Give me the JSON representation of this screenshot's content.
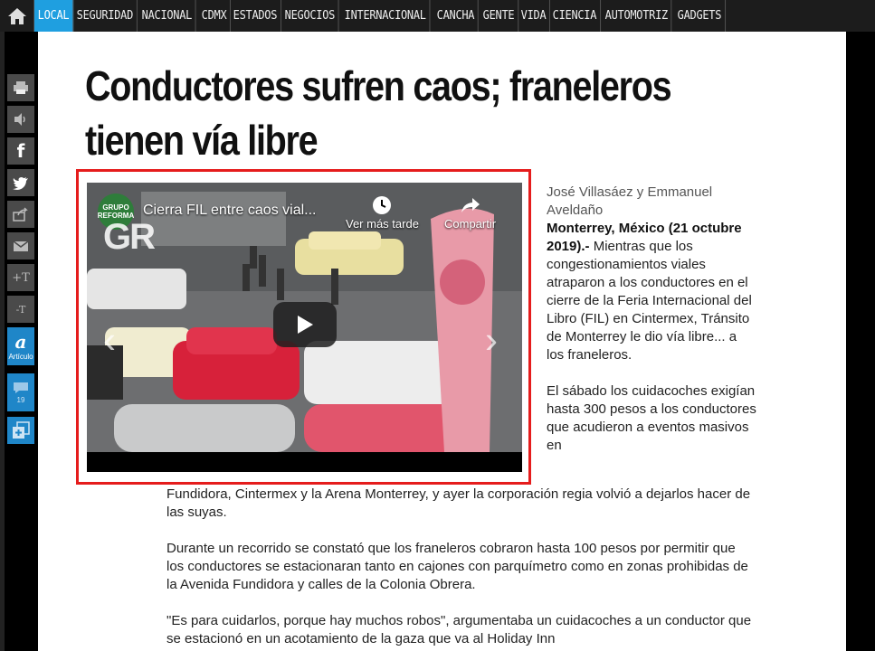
{
  "nav": {
    "items": [
      "LOCAL",
      "SEGURIDAD",
      "NACIONAL",
      "CDMX",
      "ESTADOS",
      "NEGOCIOS",
      "INTERNACIONAL",
      "CANCHA",
      "GENTE",
      "VIDA",
      "CIENCIA",
      "AUTOMOTRIZ",
      "GADGETS"
    ],
    "active": "LOCAL"
  },
  "sidebar": {
    "article_label": "Artículo",
    "comments_count": "19"
  },
  "article": {
    "title_line1": "Conductores sufren caos; franeleros",
    "title_line2": "tienen vía libre",
    "authors": "José Villasáez y Emmanuel Aveldaño",
    "dateline": "Monterrey, México (21 octubre 2019).-",
    "col_p1": "Mientras que los congestionamientos viales atraparon a los conductores en el cierre de la Feria Internacional del Libro (FIL) en Cintermex, Tránsito de Monterrey le dio vía libre... a los franeleros.",
    "col_p2": "El sábado los cuidacoches exigían hasta 300 pesos a los conductores que acudieron a eventos masivos en",
    "p2_cont": "Fundidora, Cintermex y la Arena Monterrey, y ayer la corporación regia volvió a dejarlos hacer de las suyas.",
    "p3": "Durante un recorrido se constató que los franeleros cobraron hasta 100 pesos por permitir que los conductores se estacionaran tanto en cajones con parquímetro como en zonas prohibidas de la Avenida Fundidora y calles de la Colonia Obrera.",
    "p4": "\"Es para cuidarlos, porque hay muchos robos\", argumentaba un cuidacoches a un conductor que se estacionó en un acotamiento de la gaza que va al Holiday Inn"
  },
  "video": {
    "title": "Cierra FIL entre caos vial...",
    "watch_later": "Ver más tarde",
    "share": "Compartir",
    "watermark": "GR",
    "channel_logo_text": "GRUPO REFORMA"
  },
  "colors": {
    "nav_active": "#1f9fe0",
    "highlight_border": "#e51c1c",
    "share_blue": "#1f86c8"
  }
}
